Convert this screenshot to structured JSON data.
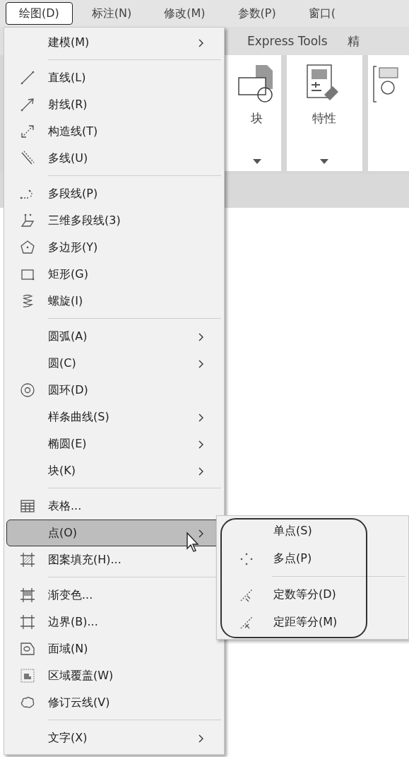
{
  "menubar": [
    {
      "label": "绘图(D)",
      "selected": true
    },
    {
      "label": "标注(N)",
      "selected": false
    },
    {
      "label": "修改(M)",
      "selected": false
    },
    {
      "label": "参数(P)",
      "selected": false
    },
    {
      "label": "窗口(",
      "selected": false
    }
  ],
  "ribbon_tabs": [
    "Express Tools",
    "精"
  ],
  "ribbon_panels": [
    {
      "label": "块"
    },
    {
      "label": "特性"
    }
  ],
  "menu": {
    "items": [
      {
        "kind": "item",
        "label": "建模(M)",
        "submenu": true,
        "selected": false
      },
      {
        "kind": "separator"
      },
      {
        "kind": "item",
        "label": "直线(L)",
        "submenu": false,
        "selected": false
      },
      {
        "kind": "item",
        "label": "射线(R)",
        "submenu": false,
        "selected": false
      },
      {
        "kind": "item",
        "label": "构造线(T)",
        "submenu": false,
        "selected": false
      },
      {
        "kind": "item",
        "label": "多线(U)",
        "submenu": false,
        "selected": false
      },
      {
        "kind": "separator"
      },
      {
        "kind": "item",
        "label": "多段线(P)",
        "submenu": false,
        "selected": false
      },
      {
        "kind": "item",
        "label": "三维多段线(3)",
        "submenu": false,
        "selected": false
      },
      {
        "kind": "item",
        "label": "多边形(Y)",
        "submenu": false,
        "selected": false
      },
      {
        "kind": "item",
        "label": "矩形(G)",
        "submenu": false,
        "selected": false
      },
      {
        "kind": "item",
        "label": "螺旋(I)",
        "submenu": false,
        "selected": false
      },
      {
        "kind": "separator"
      },
      {
        "kind": "item",
        "label": "圆弧(A)",
        "submenu": true,
        "selected": false
      },
      {
        "kind": "item",
        "label": "圆(C)",
        "submenu": true,
        "selected": false
      },
      {
        "kind": "item",
        "label": "圆环(D)",
        "submenu": false,
        "selected": false
      },
      {
        "kind": "item",
        "label": "样条曲线(S)",
        "submenu": true,
        "selected": false
      },
      {
        "kind": "item",
        "label": "椭圆(E)",
        "submenu": true,
        "selected": false
      },
      {
        "kind": "item",
        "label": "块(K)",
        "submenu": true,
        "selected": false
      },
      {
        "kind": "separator"
      },
      {
        "kind": "item",
        "label": "表格...",
        "submenu": false,
        "selected": false
      },
      {
        "kind": "item",
        "label": "点(O)",
        "submenu": true,
        "selected": true
      },
      {
        "kind": "item",
        "label": "图案填充(H)...",
        "submenu": false,
        "selected": false
      },
      {
        "kind": "separator"
      },
      {
        "kind": "item",
        "label": "渐变色...",
        "submenu": false,
        "selected": false
      },
      {
        "kind": "item",
        "label": "边界(B)...",
        "submenu": false,
        "selected": false
      },
      {
        "kind": "item",
        "label": "面域(N)",
        "submenu": false,
        "selected": false
      },
      {
        "kind": "item",
        "label": "区域覆盖(W)",
        "submenu": false,
        "selected": false
      },
      {
        "kind": "item",
        "label": "修订云线(V)",
        "submenu": false,
        "selected": false
      },
      {
        "kind": "separator"
      },
      {
        "kind": "item",
        "label": "文字(X)",
        "submenu": true,
        "selected": false
      }
    ]
  },
  "submenu": {
    "items": [
      {
        "kind": "item",
        "label": "单点(S)",
        "selected": false
      },
      {
        "kind": "item",
        "label": "多点(P)",
        "selected": false
      },
      {
        "kind": "separator"
      },
      {
        "kind": "item",
        "label": "定数等分(D)",
        "selected": false
      },
      {
        "kind": "item",
        "label": "定距等分(M)",
        "selected": false
      }
    ]
  }
}
